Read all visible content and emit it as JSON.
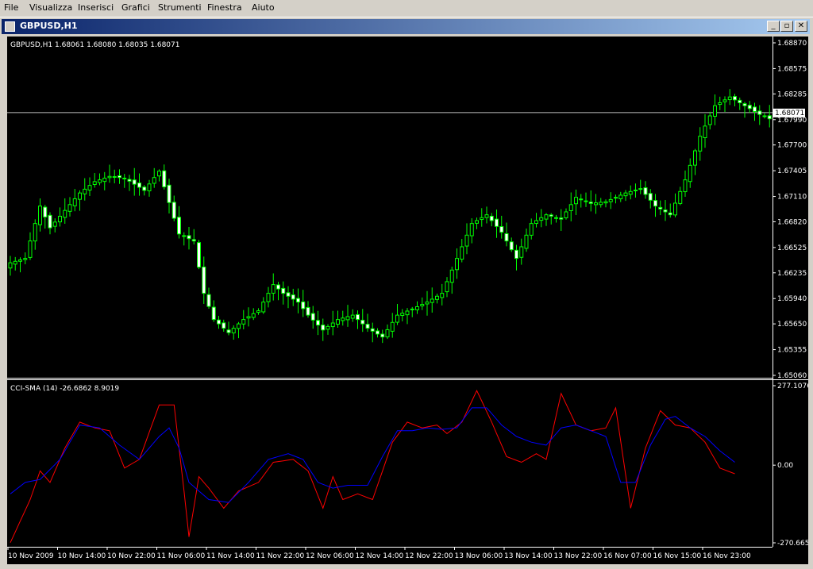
{
  "menu": [
    "File",
    "Visualizza",
    "Inserisci",
    "Grafici",
    "Strumenti",
    "Finestra",
    "Aiuto"
  ],
  "window": {
    "title": "GBPUSD,H1",
    "minimize_glyph": "_",
    "restore_glyph": "▫",
    "close_glyph": "✕"
  },
  "colors": {
    "background": "#000000",
    "candle": "#00ff00",
    "bull_body": "#000000",
    "bear_body": "#ffffff",
    "cci_line": "#ff0000",
    "sma_line": "#0000ff",
    "current_price_line": "#c0c0c0",
    "price_tag_bg": "#ffffff"
  },
  "chart_data": [
    {
      "type": "candlestick",
      "info_label": "GBPUSD,H1  1.68061 1.68080 1.68035 1.68071",
      "symbol": "GBPUSD",
      "timeframe": "H1",
      "ohlc_current": [
        1.68061,
        1.6808,
        1.68035,
        1.68071
      ],
      "current_price": 1.68071,
      "current_price_label": "1.68071",
      "ylim": [
        1.6506,
        1.6887
      ],
      "y_ticks": [
        "1.68870",
        "1.68575",
        "1.68285",
        "1.67990",
        "1.67700",
        "1.67405",
        "1.67110",
        "1.66820",
        "1.66525",
        "1.66235",
        "1.65940",
        "1.65650",
        "1.65355",
        "1.65060"
      ],
      "y_tick_values": [
        1.6887,
        1.68575,
        1.68285,
        1.6799,
        1.677,
        1.67405,
        1.6711,
        1.6682,
        1.66525,
        1.66235,
        1.6594,
        1.6565,
        1.65355,
        1.6506
      ],
      "close_keypoints": [
        [
          0,
          1.6635
        ],
        [
          3,
          1.664
        ],
        [
          6,
          1.67
        ],
        [
          8,
          1.6675
        ],
        [
          11,
          1.6695
        ],
        [
          14,
          1.6715
        ],
        [
          17,
          1.6728
        ],
        [
          20,
          1.6734
        ],
        [
          23,
          1.6732
        ],
        [
          27,
          1.6718
        ],
        [
          30,
          1.674
        ],
        [
          34,
          1.6668
        ],
        [
          37,
          1.666
        ],
        [
          39,
          1.66
        ],
        [
          41,
          1.657
        ],
        [
          44,
          1.6555
        ],
        [
          47,
          1.657
        ],
        [
          50,
          1.658
        ],
        [
          53,
          1.661
        ],
        [
          55,
          1.66
        ],
        [
          58,
          1.659
        ],
        [
          60,
          1.6575
        ],
        [
          63,
          1.6558
        ],
        [
          66,
          1.657
        ],
        [
          69,
          1.6575
        ],
        [
          72,
          1.656
        ],
        [
          75,
          1.655
        ],
        [
          78,
          1.6575
        ],
        [
          81,
          1.6582
        ],
        [
          84,
          1.659
        ],
        [
          87,
          1.66
        ],
        [
          90,
          1.664
        ],
        [
          93,
          1.668
        ],
        [
          96,
          1.669
        ],
        [
          99,
          1.667
        ],
        [
          102,
          1.664
        ],
        [
          105,
          1.668
        ],
        [
          108,
          1.669
        ],
        [
          111,
          1.6685
        ],
        [
          114,
          1.671
        ],
        [
          117,
          1.6703
        ],
        [
          120,
          1.6705
        ],
        [
          124,
          1.6715
        ],
        [
          127,
          1.672
        ],
        [
          130,
          1.67
        ],
        [
          133,
          1.669
        ],
        [
          136,
          1.673
        ],
        [
          139,
          1.678
        ],
        [
          142,
          1.6815
        ],
        [
          145,
          1.6825
        ],
        [
          148,
          1.6815
        ],
        [
          151,
          1.6805
        ],
        [
          153,
          1.68
        ]
      ],
      "bar_count": 154,
      "x_tick_labels": [
        "10 Nov 2009",
        "10 Nov 14:00",
        "10 Nov 22:00",
        "11 Nov 06:00",
        "11 Nov 14:00",
        "11 Nov 22:00",
        "12 Nov 06:00",
        "12 Nov 14:00",
        "12 Nov 22:00",
        "13 Nov 06:00",
        "13 Nov 14:00",
        "13 Nov 22:00",
        "16 Nov 07:00",
        "16 Nov 15:00",
        "16 Nov 23:00"
      ],
      "x_tick_bars": [
        0,
        10,
        20,
        30,
        40,
        50,
        60,
        70,
        80,
        90,
        100,
        110,
        120,
        130,
        140
      ]
    },
    {
      "type": "line",
      "info_label": "CCI-SMA (14)  -26.6862 8.9019",
      "indicator": "CCI-SMA",
      "period": 14,
      "current_values": [
        -26.6862,
        8.9019
      ],
      "ylim": [
        -270.665,
        277.1076
      ],
      "y_ticks": [
        "277.1076",
        "0.00",
        "-270.665"
      ],
      "y_tick_values": [
        277.1076,
        0,
        -270.665
      ],
      "series": [
        {
          "name": "CCI",
          "color": "#ff0000",
          "keypoints": [
            [
              0,
              -270
            ],
            [
              4,
              -120
            ],
            [
              6,
              -20
            ],
            [
              8,
              -60
            ],
            [
              11,
              60
            ],
            [
              14,
              150
            ],
            [
              17,
              130
            ],
            [
              20,
              120
            ],
            [
              23,
              -10
            ],
            [
              26,
              20
            ],
            [
              30,
              210
            ],
            [
              33,
              210
            ],
            [
              35,
              -90
            ],
            [
              36,
              -250
            ],
            [
              38,
              -40
            ],
            [
              40,
              -80
            ],
            [
              43,
              -150
            ],
            [
              46,
              -90
            ],
            [
              50,
              -60
            ],
            [
              53,
              10
            ],
            [
              57,
              20
            ],
            [
              60,
              -20
            ],
            [
              63,
              -150
            ],
            [
              65,
              -40
            ],
            [
              67,
              -120
            ],
            [
              70,
              -100
            ],
            [
              73,
              -120
            ],
            [
              77,
              80
            ],
            [
              80,
              150
            ],
            [
              83,
              130
            ],
            [
              86,
              140
            ],
            [
              88,
              110
            ],
            [
              91,
              150
            ],
            [
              94,
              260
            ],
            [
              97,
              150
            ],
            [
              100,
              30
            ],
            [
              103,
              10
            ],
            [
              106,
              40
            ],
            [
              108,
              20
            ],
            [
              111,
              250
            ],
            [
              114,
              140
            ],
            [
              117,
              120
            ],
            [
              120,
              130
            ],
            [
              122,
              200
            ],
            [
              125,
              -150
            ],
            [
              128,
              60
            ],
            [
              131,
              190
            ],
            [
              134,
              140
            ],
            [
              137,
              130
            ],
            [
              140,
              80
            ],
            [
              143,
              -10
            ],
            [
              146,
              -30
            ]
          ]
        },
        {
          "name": "SMA",
          "color": "#0000ff",
          "keypoints": [
            [
              0,
              -100
            ],
            [
              3,
              -60
            ],
            [
              6,
              -50
            ],
            [
              10,
              20
            ],
            [
              14,
              140
            ],
            [
              18,
              130
            ],
            [
              22,
              70
            ],
            [
              26,
              20
            ],
            [
              30,
              100
            ],
            [
              32,
              130
            ],
            [
              34,
              60
            ],
            [
              36,
              -60
            ],
            [
              40,
              -120
            ],
            [
              44,
              -130
            ],
            [
              48,
              -60
            ],
            [
              52,
              20
            ],
            [
              56,
              40
            ],
            [
              59,
              20
            ],
            [
              62,
              -60
            ],
            [
              65,
              -80
            ],
            [
              68,
              -70
            ],
            [
              72,
              -70
            ],
            [
              75,
              30
            ],
            [
              78,
              120
            ],
            [
              81,
              120
            ],
            [
              84,
              130
            ],
            [
              87,
              125
            ],
            [
              90,
              130
            ],
            [
              93,
              200
            ],
            [
              96,
              200
            ],
            [
              99,
              140
            ],
            [
              102,
              100
            ],
            [
              105,
              80
            ],
            [
              108,
              70
            ],
            [
              111,
              130
            ],
            [
              114,
              140
            ],
            [
              117,
              120
            ],
            [
              120,
              100
            ],
            [
              123,
              -60
            ],
            [
              126,
              -60
            ],
            [
              129,
              70
            ],
            [
              132,
              160
            ],
            [
              134,
              170
            ],
            [
              137,
              130
            ],
            [
              140,
              100
            ],
            [
              143,
              50
            ],
            [
              146,
              10
            ]
          ]
        }
      ]
    }
  ]
}
